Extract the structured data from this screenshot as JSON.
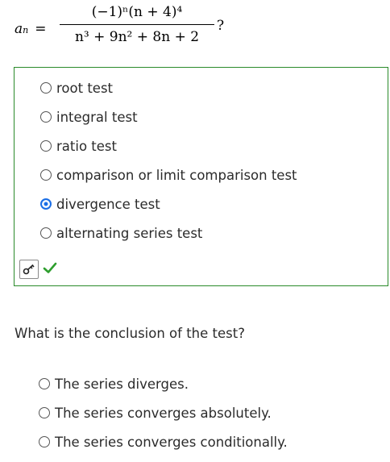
{
  "formula": {
    "lhs_var": "a",
    "lhs_sub": "n",
    "equals": "=",
    "numerator": "(−1)ⁿ(n + 4)⁴",
    "denominator": "n³ + 9n² + 8n + 2",
    "question_mark": "?"
  },
  "test_options": [
    {
      "label": "root test",
      "selected": false
    },
    {
      "label": "integral test",
      "selected": false
    },
    {
      "label": "ratio test",
      "selected": false
    },
    {
      "label": "comparison or limit comparison test",
      "selected": false
    },
    {
      "label": "divergence test",
      "selected": true
    },
    {
      "label": "alternating series test",
      "selected": false
    }
  ],
  "status": {
    "key_icon": "key-icon",
    "result_icon": "checkmark-icon",
    "result_color": "#2e9e2e"
  },
  "conclusion": {
    "prompt": "What is the conclusion of the test?",
    "options": [
      {
        "label": "The series diverges.",
        "selected": false
      },
      {
        "label": "The series converges absolutely.",
        "selected": false
      },
      {
        "label": "The series converges conditionally.",
        "selected": false
      }
    ]
  },
  "colors": {
    "box_border": "#2a8a2a",
    "selected_radio": "#1a6ee6"
  }
}
